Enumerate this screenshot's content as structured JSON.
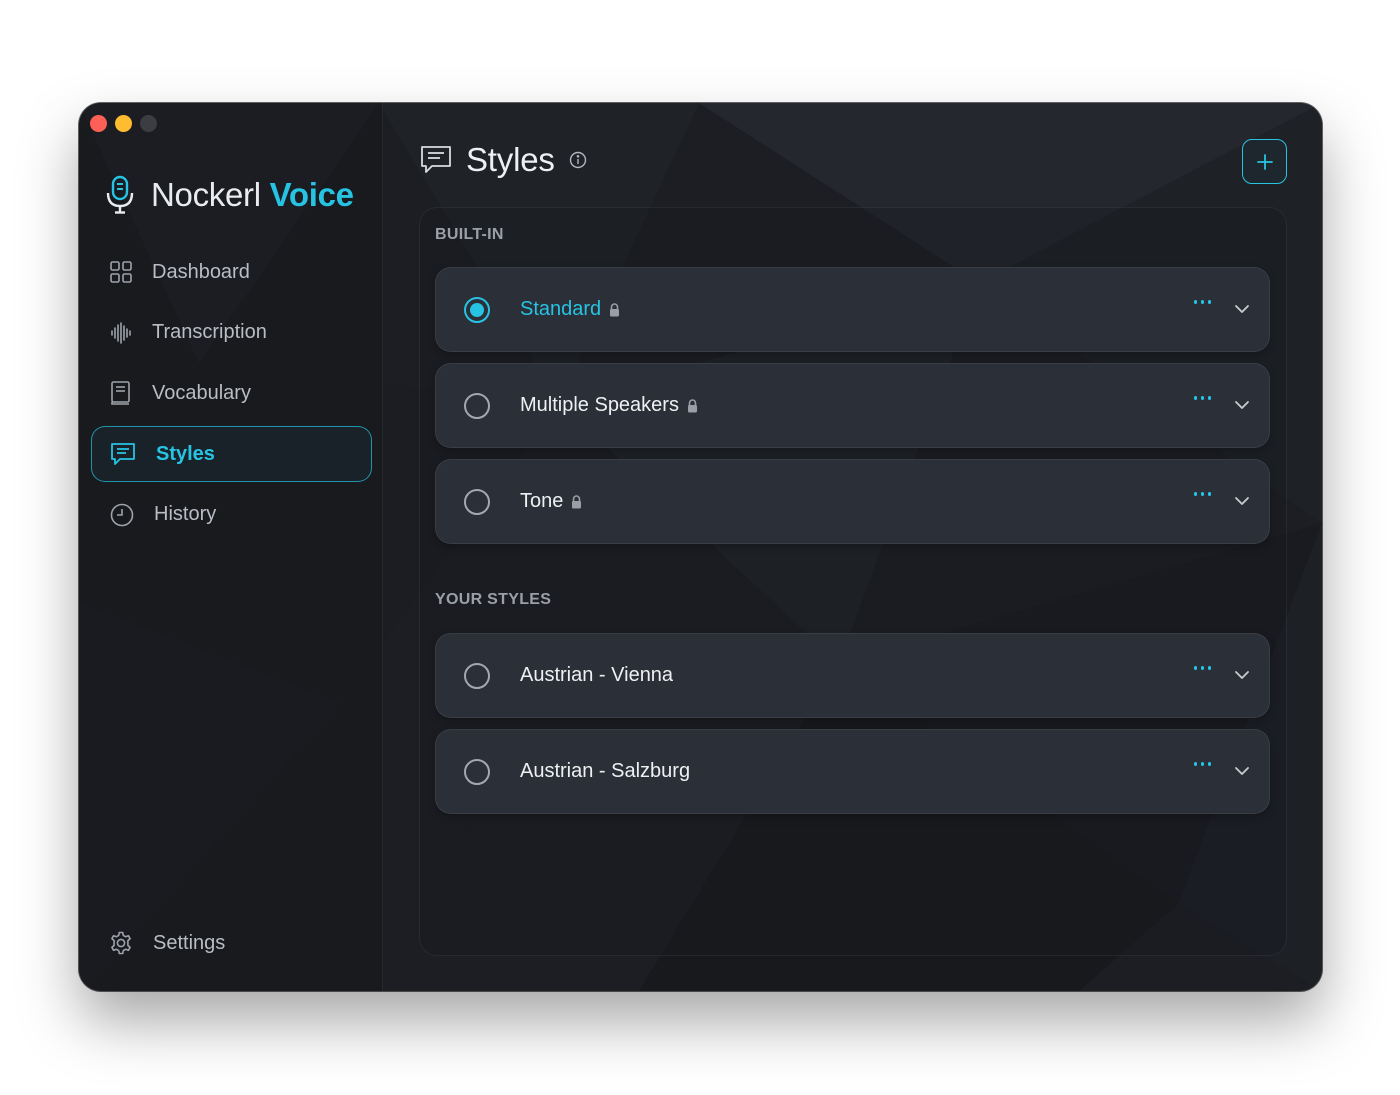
{
  "app": {
    "brand_primary": "Nockerl",
    "brand_accent": "Voice",
    "accent_color": "#27c3e3"
  },
  "sidebar": {
    "items": [
      {
        "label": "Dashboard",
        "icon": "grid-icon",
        "active": false
      },
      {
        "label": "Transcription",
        "icon": "waveform-icon",
        "active": false
      },
      {
        "label": "Vocabulary",
        "icon": "book-icon",
        "active": false
      },
      {
        "label": "Styles",
        "icon": "chat-lines-icon",
        "active": true
      },
      {
        "label": "History",
        "icon": "clock-icon",
        "active": false
      }
    ],
    "settings_label": "Settings"
  },
  "header": {
    "title": "Styles",
    "info_icon": "info-icon",
    "add_icon": "plus-icon"
  },
  "builtin": {
    "label": "BUILT-IN",
    "styles": [
      {
        "name": "Standard",
        "locked": true,
        "selected": true
      },
      {
        "name": "Multiple Speakers",
        "locked": true,
        "selected": false
      },
      {
        "name": "Tone",
        "locked": true,
        "selected": false
      }
    ]
  },
  "custom": {
    "label": "YOUR STYLES",
    "styles": [
      {
        "name": "Austrian - Vienna",
        "locked": false,
        "selected": false
      },
      {
        "name": "Austrian - Salzburg",
        "locked": false,
        "selected": false
      }
    ]
  }
}
